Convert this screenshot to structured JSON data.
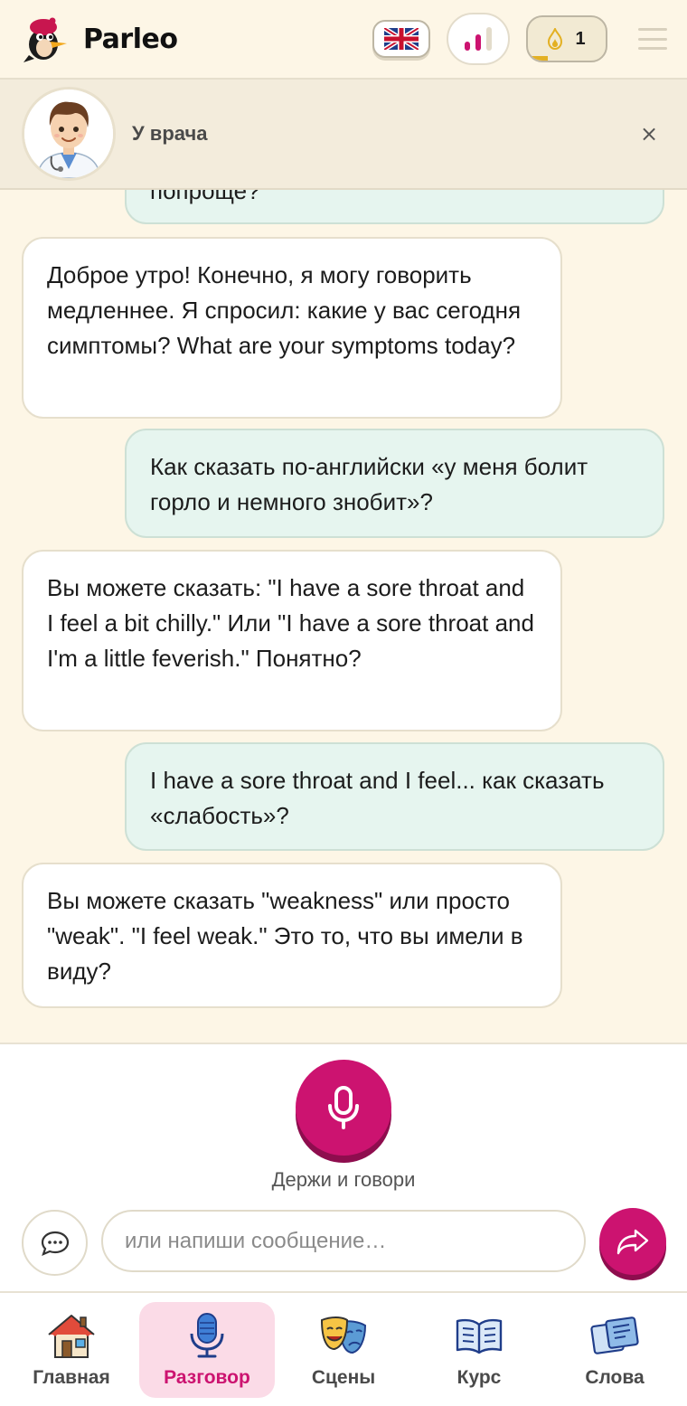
{
  "app": {
    "name": "Parleo"
  },
  "header": {
    "language_icon": "uk-flag-icon",
    "level_icon": "signal-bars-icon",
    "streak": {
      "icon": "flame-icon",
      "count": "1",
      "progress": 0.25
    },
    "menu_icon": "hamburger-menu-icon"
  },
  "scene": {
    "title": "У врача",
    "close_label": "×",
    "avatar_icon": "doctor-avatar"
  },
  "messages": [
    {
      "role": "user",
      "text": "попроще?"
    },
    {
      "role": "bot",
      "text": "Доброе утро! Конечно, я могу говорить медленнее. Я спросил: какие у вас сегодня симптомы? What are your symptoms today?"
    },
    {
      "role": "user",
      "text": "Как сказать по-английски «у меня болит горло и немного знобит»?"
    },
    {
      "role": "bot",
      "text": "Вы можете сказать: \"I have a sore throat and I feel a bit chilly.\" Или \"I have a sore throat and I'm a little feverish.\" Понятно?"
    },
    {
      "role": "user",
      "text": "I have a sore throat and I feel... как сказать «слабость»?"
    },
    {
      "role": "bot",
      "text": "Вы можете сказать \"weakness\" или просто \"weak\". \"I feel weak.\" Это то, что вы имели в виду?"
    }
  ],
  "composer": {
    "mic_hint": "Держи и говори",
    "input_placeholder": "или напиши сообщение…",
    "input_value": ""
  },
  "nav": [
    {
      "label": "Главная",
      "icon": "home-icon",
      "active": false
    },
    {
      "label": "Разговор",
      "icon": "microphone-icon",
      "active": true
    },
    {
      "label": "Сцены",
      "icon": "theater-masks-icon",
      "active": false
    },
    {
      "label": "Курс",
      "icon": "open-book-icon",
      "active": false
    },
    {
      "label": "Слова",
      "icon": "word-cards-icon",
      "active": false
    }
  ],
  "colors": {
    "accent": "#cc1370",
    "background": "#fdf6e6",
    "user_bubble": "#e6f5ef",
    "streak": "#e3b023"
  }
}
